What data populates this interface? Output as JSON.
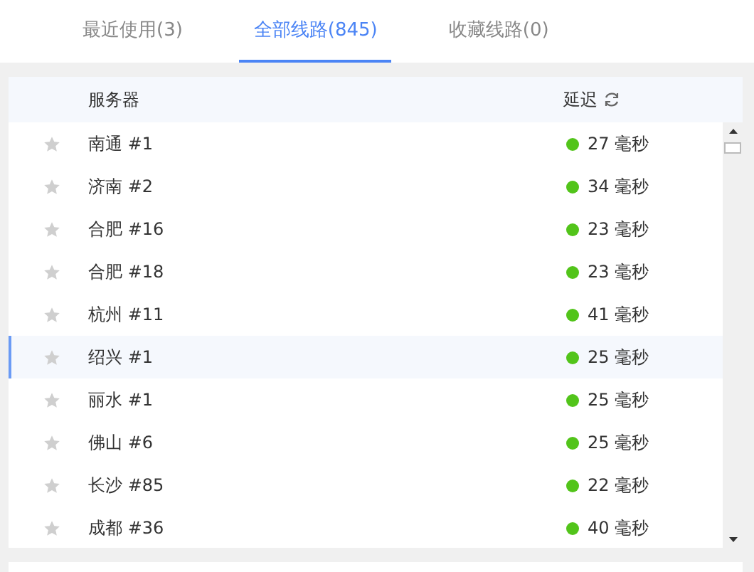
{
  "tabs": [
    {
      "label": "最近使用(3)",
      "selected": false
    },
    {
      "label": "全部线路(845)",
      "selected": true
    },
    {
      "label": "收藏线路(0)",
      "selected": false
    }
  ],
  "table": {
    "columns": [
      "服务器",
      "延迟"
    ],
    "rows": [
      {
        "server": "南通 #1",
        "latency": "27 毫秒",
        "color": "#52c41a",
        "favorite": false,
        "selected": false
      },
      {
        "server": "济南 #2",
        "latency": "34 毫秒",
        "color": "#52c41a",
        "favorite": false,
        "selected": false
      },
      {
        "server": "合肥 #16",
        "latency": "23 毫秒",
        "color": "#52c41a",
        "favorite": false,
        "selected": false
      },
      {
        "server": "合肥 #18",
        "latency": "23 毫秒",
        "color": "#52c41a",
        "favorite": false,
        "selected": false
      },
      {
        "server": "杭州 #11",
        "latency": "41 毫秒",
        "color": "#52c41a",
        "favorite": false,
        "selected": false
      },
      {
        "server": "绍兴 #1",
        "latency": "25 毫秒",
        "color": "#52c41a",
        "favorite": false,
        "selected": true
      },
      {
        "server": "丽水 #1",
        "latency": "25 毫秒",
        "color": "#52c41a",
        "favorite": false,
        "selected": false
      },
      {
        "server": "佛山 #6",
        "latency": "25 毫秒",
        "color": "#52c41a",
        "favorite": false,
        "selected": false
      },
      {
        "server": "长沙 #85",
        "latency": "22 毫秒",
        "color": "#52c41a",
        "favorite": false,
        "selected": false
      },
      {
        "server": "成都 #36",
        "latency": "40 毫秒",
        "color": "#52c41a",
        "favorite": false,
        "selected": false
      }
    ]
  }
}
